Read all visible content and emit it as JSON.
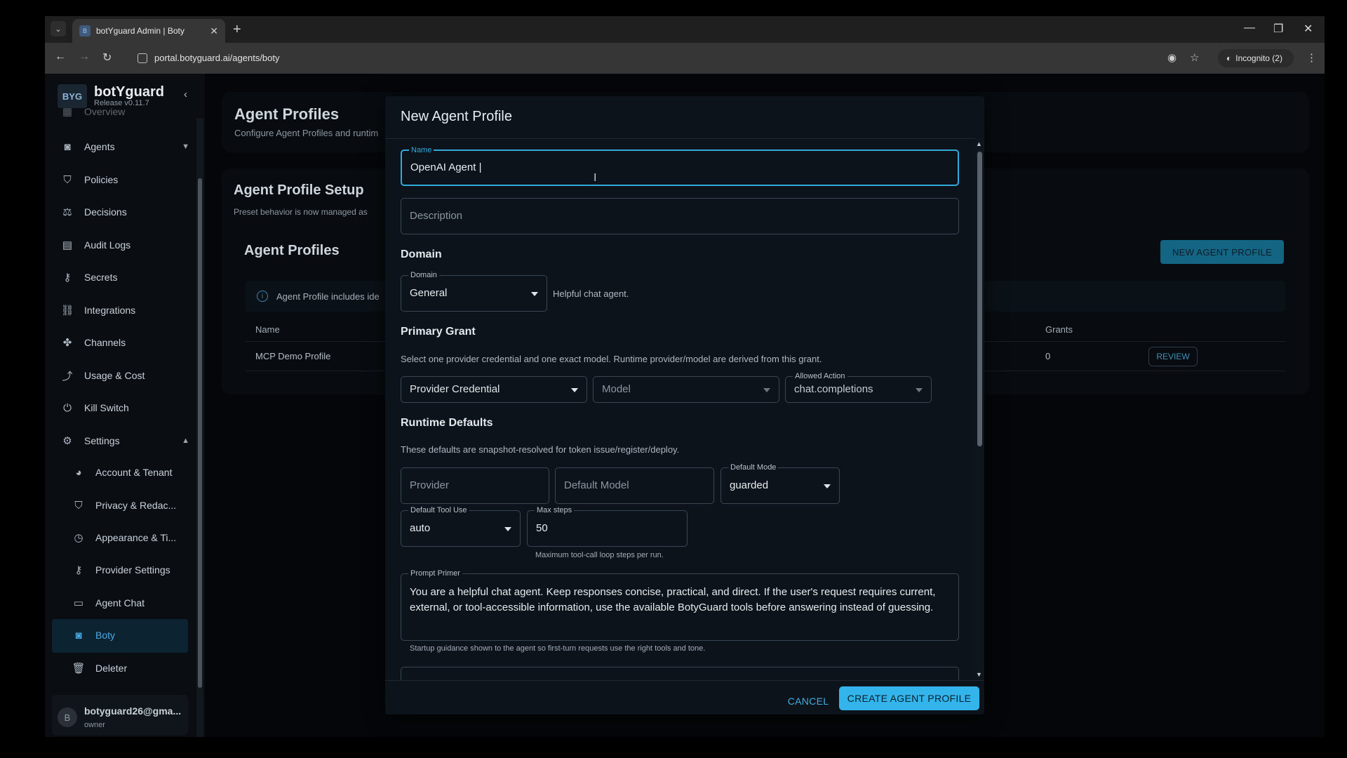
{
  "browser": {
    "tab_title": "botYguard Admin | Boty",
    "url": "portal.botyguard.ai/agents/boty",
    "incognito_label": "Incognito (2)"
  },
  "brand": {
    "name": "botYguard",
    "release": "Release v0.11.7",
    "logo_text": "BYG"
  },
  "sidebar": {
    "partial_top": "Overview",
    "items": [
      {
        "label": "Agents",
        "icon": "robot-icon"
      },
      {
        "label": "Policies",
        "icon": "shield-icon"
      },
      {
        "label": "Decisions",
        "icon": "gavel-icon"
      },
      {
        "label": "Audit Logs",
        "icon": "document-icon"
      },
      {
        "label": "Secrets",
        "icon": "key-icon"
      },
      {
        "label": "Integrations",
        "icon": "integration-icon"
      },
      {
        "label": "Channels",
        "icon": "hub-icon"
      },
      {
        "label": "Usage & Cost",
        "icon": "chart-icon"
      },
      {
        "label": "Kill Switch",
        "icon": "power-icon"
      },
      {
        "label": "Settings",
        "icon": "gear-icon"
      }
    ],
    "settings_items": [
      {
        "label": "Account & Tenant",
        "icon": "account-icon"
      },
      {
        "label": "Privacy & Redac...",
        "icon": "privacy-shield-icon"
      },
      {
        "label": "Appearance & Ti...",
        "icon": "clock-icon"
      },
      {
        "label": "Provider Settings",
        "icon": "key-icon"
      },
      {
        "label": "Agent Chat",
        "icon": "chat-icon"
      },
      {
        "label": "Boty",
        "icon": "robot-icon"
      },
      {
        "label": "Deleter",
        "icon": "delete-icon"
      }
    ],
    "user": {
      "avatar": "B",
      "email": "botyguard26@gma...",
      "role": "owner"
    }
  },
  "page": {
    "title": "Agent Profiles",
    "subtitle": "Configure Agent Profiles and runtim",
    "setup_title": "Agent Profile Setup",
    "setup_subtitle": "Preset behavior is now managed as",
    "list_title": "Agent Profiles",
    "info_text": "Agent Profile includes ide",
    "new_button": "NEW AGENT PROFILE",
    "table": {
      "headers": {
        "name": "Name",
        "grants": "Grants"
      },
      "rows": [
        {
          "name": "MCP Demo Profile",
          "grants": "0",
          "action": "REVIEW"
        }
      ]
    }
  },
  "modal": {
    "title": "New Agent Profile",
    "name": {
      "label": "Name",
      "value": "OpenAI Agent |"
    },
    "description": {
      "placeholder": "Description"
    },
    "domain_section": "Domain",
    "domain": {
      "label": "Domain",
      "value": "General",
      "helper": "Helpful chat agent."
    },
    "primary_grant_section": "Primary Grant",
    "primary_grant_hint": "Select one provider credential and one exact model. Runtime provider/model are derived from this grant.",
    "provider_credential": {
      "placeholder": "Provider Credential"
    },
    "model": {
      "placeholder": "Model"
    },
    "allowed_action": {
      "label": "Allowed Action",
      "value": "chat.completions"
    },
    "runtime_section": "Runtime Defaults",
    "runtime_hint": "These defaults are snapshot-resolved for token issue/register/deploy.",
    "provider": {
      "placeholder": "Provider"
    },
    "default_model": {
      "placeholder": "Default Model"
    },
    "default_mode": {
      "label": "Default Mode",
      "value": "guarded"
    },
    "default_tool_use": {
      "label": "Default Tool Use",
      "value": "auto"
    },
    "max_steps": {
      "label": "Max steps",
      "value": "50",
      "helper": "Maximum tool-call loop steps per run."
    },
    "prompt_primer": {
      "label": "Prompt Primer",
      "value": "You are a helpful chat agent. Keep responses concise, practical, and direct. If the user's request requires current, external, or tool-accessible information, use the available BotyGuard tools before answering instead of guessing.",
      "helper": "Startup guidance shown to the agent so first-turn requests use the right tools and tone."
    },
    "cancel": "CANCEL",
    "create": "CREATE AGENT PROFILE"
  }
}
